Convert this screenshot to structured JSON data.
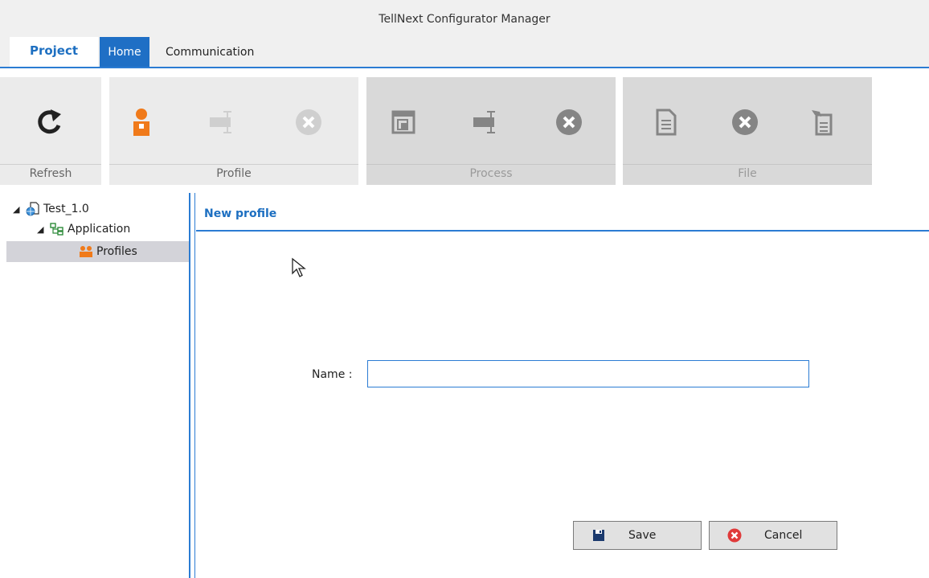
{
  "window": {
    "title": "TellNext Configurator Manager"
  },
  "menu": {
    "tabs": [
      {
        "label": "Project"
      },
      {
        "label": "Home"
      },
      {
        "label": "Communication"
      }
    ]
  },
  "ribbon": {
    "groups": [
      {
        "label": "Refresh",
        "enabled": true,
        "buttons": [
          "refresh-icon"
        ]
      },
      {
        "label": "Profile",
        "enabled": true,
        "buttons": [
          "add-profile-icon",
          "rename-icon",
          "delete-icon"
        ]
      },
      {
        "label": "Process",
        "enabled": false,
        "buttons": [
          "copy-window-icon",
          "rename-icon",
          "delete-icon"
        ]
      },
      {
        "label": "File",
        "enabled": false,
        "buttons": [
          "document-icon",
          "delete-icon",
          "edit-document-icon"
        ]
      }
    ]
  },
  "tree": {
    "items": [
      {
        "label": "Test_1.0",
        "icon": "globe-document-icon",
        "expanded": true
      },
      {
        "label": "Application",
        "icon": "tree-structure-icon",
        "expanded": true
      },
      {
        "label": "Profiles",
        "icon": "users-icon",
        "selected": true
      }
    ]
  },
  "panel": {
    "title": "New profile",
    "name_label": "Name :",
    "name_value": "",
    "name_placeholder": "",
    "save_label": "Save",
    "cancel_label": "Cancel"
  },
  "colors": {
    "accent": "#2b7cd3",
    "home_tab": "#1f6fc5",
    "profile_orange": "#f07a1a",
    "cancel_red": "#e03a3a",
    "disabled_group": "#d9d9d9"
  }
}
